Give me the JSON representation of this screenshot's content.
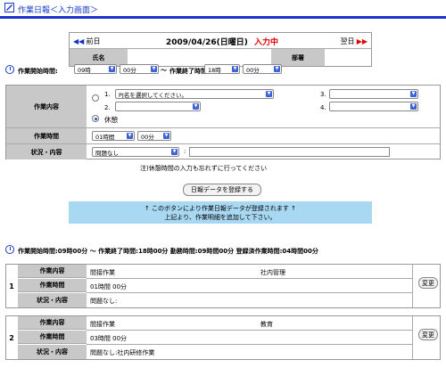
{
  "header": {
    "title": "作業日報＜入力画面＞"
  },
  "nav": {
    "prev": "前日",
    "next": "翌日",
    "date": "2009/04/26(日曜日)",
    "status": "入力中",
    "name_label": "氏名",
    "name_value": "",
    "dept_label": "部署",
    "dept_value": "",
    "prev_icon": "double-left-arrow-icon",
    "next_icon": "double-right-arrow-icon"
  },
  "time_bar": {
    "start_label": "作業開始時間:",
    "start_hour": "09時",
    "start_min": "00分",
    "tilde": "〜",
    "end_label": "作業終了時間:",
    "end_hour": "18時",
    "end_min": "00分"
  },
  "form": {
    "content_label": "作業内容",
    "slots": [
      {
        "num": "1.",
        "value": "PJ名を選択してください。"
      },
      {
        "num": "2.",
        "value": ""
      },
      {
        "num": "3.",
        "value": ""
      },
      {
        "num": "4.",
        "value": ""
      }
    ],
    "rest_label": "休憩",
    "time_label": "作業時間",
    "time_hour": "01時間",
    "time_min": "00分",
    "status_label": "状況・内容",
    "status_value": "問題なし",
    "colon": ":",
    "note": "注)休憩時間の入力も忘れずに行ってください"
  },
  "register_button": "日報データを登録する",
  "info": {
    "line1": "↑ このボタンにより作業日報データが登録されます ↑",
    "line2": "上記より、作業明細を追加して下さい。"
  },
  "summary": "作業開始時間:09時00分 〜 作業終了時間:18時00分 勤務時間:09時間00分 登録済作業時間:04時間00分",
  "entries": [
    {
      "num": "1",
      "content_label": "作業内容",
      "content1": "間接作業",
      "content2": "社内管理",
      "time_label": "作業時間",
      "time": "01時間 00分",
      "status_label": "状況・内容",
      "status": "問題なし:",
      "button": "変更"
    },
    {
      "num": "2",
      "content_label": "作業内容",
      "content1": "間接作業",
      "content2": "教育",
      "time_label": "作業時間",
      "time": "03時間 00分",
      "status_label": "状況・内容",
      "status": "問題なし:社内研修作業",
      "button": "変更"
    }
  ],
  "colors": {
    "accent": "#1f33cc",
    "label_bg": "#c8c8c8",
    "info_bg": "#a9d8f2",
    "status_red": "#e00000"
  }
}
